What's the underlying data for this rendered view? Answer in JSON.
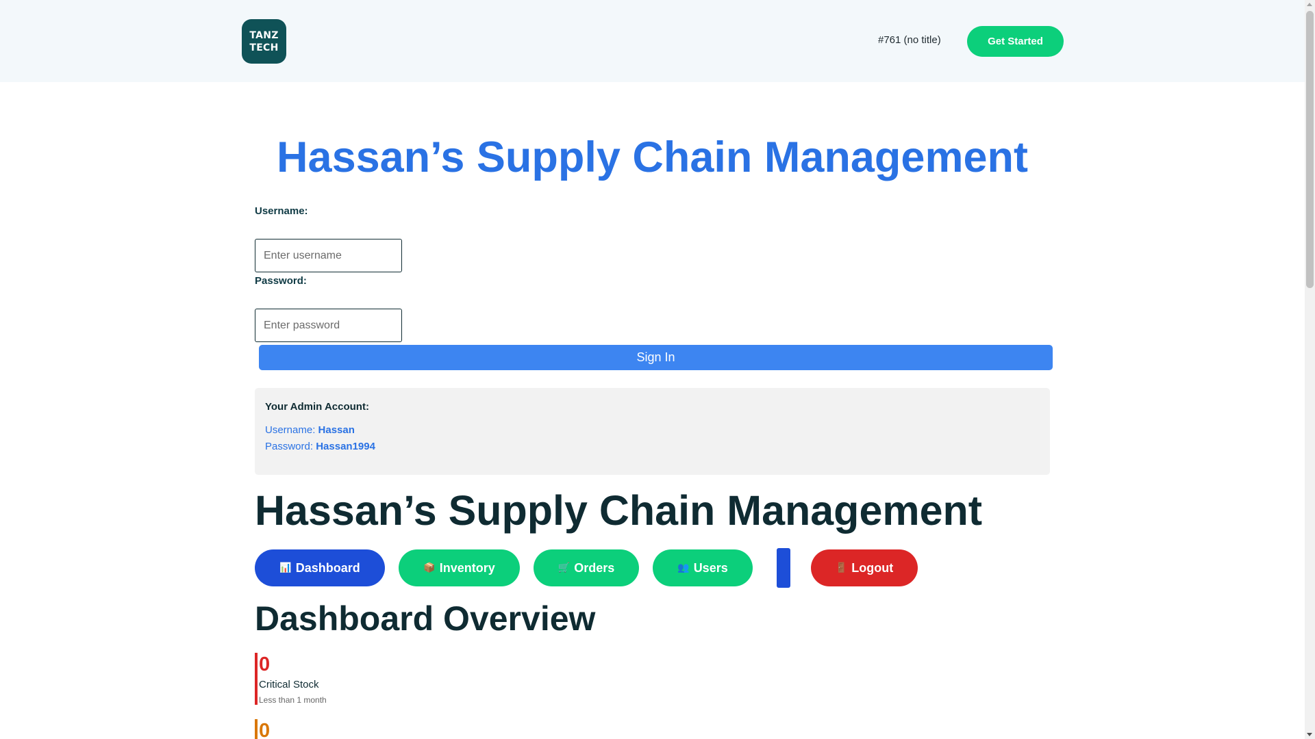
{
  "header": {
    "logo_line1": "TANZ",
    "logo_line2": "TECH",
    "link": "#761 (no title)",
    "cta": "Get Started"
  },
  "login": {
    "title": "Hassan’s Supply Chain Management",
    "username_label": "Username:",
    "username_placeholder": "Enter username",
    "password_label": "Password:",
    "password_placeholder": "Enter password",
    "sign_in": "Sign In",
    "admin": {
      "title": "Your Admin Account:",
      "username_label": "Username:",
      "username_value": "Hassan",
      "password_label": "Password:",
      "password_value": "Hassan1994"
    }
  },
  "app": {
    "title": "Hassan’s Supply Chain Management",
    "nav": [
      {
        "icon": "📊",
        "label": "Dashboard"
      },
      {
        "icon": "📦",
        "label": "Inventory"
      },
      {
        "icon": "🛒",
        "label": "Orders"
      },
      {
        "icon": "👥",
        "label": "Users"
      },
      {
        "icon": "🚪",
        "label": "Logout"
      }
    ],
    "section_title": "Dashboard Overview",
    "stats": [
      {
        "value": "0",
        "label": "Critical Stock",
        "sub": "Less than 1 month",
        "color": "#dc2626"
      },
      {
        "value": "0",
        "label": "",
        "sub": "",
        "color": "#d97706"
      }
    ]
  },
  "colors": {
    "accent_blue": "#2a72e4",
    "brand_green": "#0ccf7b",
    "logo_teal": "#0f5257",
    "danger_red": "#dc2626",
    "nav_blue": "#1d4ed8"
  }
}
